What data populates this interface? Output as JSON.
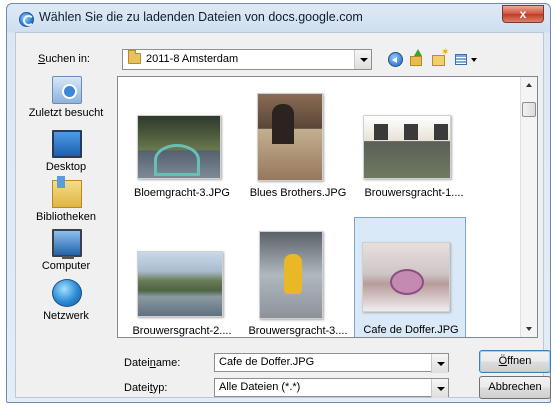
{
  "window": {
    "title": "Wählen Sie die zu ladenden Dateien von docs.google.com",
    "close_label": "x"
  },
  "lookin": {
    "label_accel": "S",
    "label_rest": "uchen in:",
    "value": "2011-8 Amsterdam"
  },
  "toolbar": {
    "icons": [
      "back-icon",
      "up-folder-icon",
      "new-folder-icon",
      "views-menu-icon"
    ]
  },
  "places": [
    {
      "label": "Zuletzt besucht",
      "icon": "recent-places-icon"
    },
    {
      "label": "Desktop",
      "icon": "desktop-icon"
    },
    {
      "label": "Bibliotheken",
      "icon": "libraries-icon"
    },
    {
      "label": "Computer",
      "icon": "computer-icon"
    },
    {
      "label": "Netzwerk",
      "icon": "network-icon"
    }
  ],
  "files": [
    {
      "name": "Bloemgracht-3.JPG",
      "selected": false
    },
    {
      "name": "Blues Brothers.JPG",
      "selected": false
    },
    {
      "name": "Brouwersgracht-1....",
      "selected": false
    },
    {
      "name": "Brouwersgracht-2....",
      "selected": false
    },
    {
      "name": "Brouwersgracht-3....",
      "selected": false
    },
    {
      "name": "Cafe de Doffer.JPG",
      "selected": true
    }
  ],
  "filename": {
    "label_pre": "Datei",
    "label_accel": "n",
    "label_post": "ame:",
    "value": "Cafe de Doffer.JPG"
  },
  "filetype": {
    "label_pre": "Datei",
    "label_accel": "t",
    "label_post": "yp:",
    "value": "Alle Dateien (*.*)"
  },
  "buttons": {
    "open_accel": "Ö",
    "open_rest": "ffnen",
    "cancel": "Abbrechen"
  },
  "colors": {
    "selection": "#d9e9f8",
    "selection_border": "#7da2ce",
    "close_button": "#c13a22"
  }
}
